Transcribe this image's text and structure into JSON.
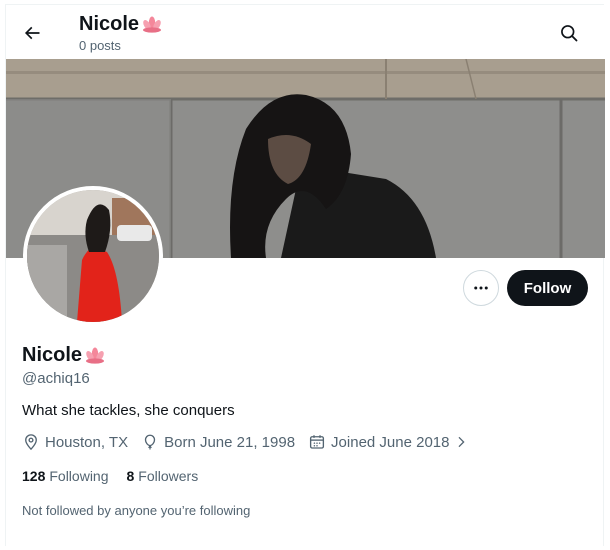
{
  "header": {
    "title": "Nicole",
    "posts": "0 posts"
  },
  "profile": {
    "name": "Nicole",
    "handle": "@achiq16",
    "bio": "What she tackles, she conquers",
    "location": "Houston, TX",
    "born": "Born June 21, 1998",
    "joined": "Joined June 2018",
    "following_count": "128",
    "following_label": "Following",
    "followers_count": "8",
    "followers_label": "Followers",
    "not_followed": "Not followed by anyone you’re following"
  },
  "actions": {
    "follow_label": "Follow"
  },
  "icons": {
    "back": "arrow-left-icon",
    "search": "search-icon",
    "more": "more-horizontal-icon",
    "location": "location-pin-icon",
    "birthday": "balloon-icon",
    "calendar": "calendar-icon",
    "chevron": "chevron-right-icon",
    "emoji": "lotus-icon"
  },
  "colors": {
    "text": "#0f1419",
    "muted": "#536471",
    "button": "#0f1419",
    "border": "#cfd9de",
    "lotus": "#f4879a"
  }
}
